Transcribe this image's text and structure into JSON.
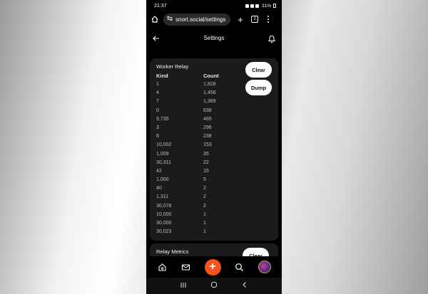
{
  "status_bar": {
    "time": "21:37",
    "battery": "31%"
  },
  "browser": {
    "url": "snort.social/settings",
    "tab_count": "2"
  },
  "header": {
    "title": "Settings"
  },
  "worker_relay": {
    "title": "Worker Relay",
    "clear_label": "Clear",
    "dump_label": "Dump",
    "columns": {
      "kind": "Kind",
      "count": "Count"
    },
    "rows": [
      {
        "kind": "1",
        "count": "1,828"
      },
      {
        "kind": "4",
        "count": "1,456"
      },
      {
        "kind": "7",
        "count": "1,369"
      },
      {
        "kind": "0",
        "count": "638"
      },
      {
        "kind": "9,735",
        "count": "465"
      },
      {
        "kind": "3",
        "count": "296"
      },
      {
        "kind": "6",
        "count": "238"
      },
      {
        "kind": "10,002",
        "count": "153"
      },
      {
        "kind": "1,009",
        "count": "35"
      },
      {
        "kind": "30,311",
        "count": "22"
      },
      {
        "kind": "42",
        "count": "15"
      },
      {
        "kind": "1,000",
        "count": "5"
      },
      {
        "kind": "40",
        "count": "2"
      },
      {
        "kind": "1,311",
        "count": "2"
      },
      {
        "kind": "30,078",
        "count": "2"
      },
      {
        "kind": "10,000",
        "count": "1"
      },
      {
        "kind": "30,000",
        "count": "1"
      },
      {
        "kind": "30,023",
        "count": "1"
      }
    ]
  },
  "relay_metrics": {
    "title": "Relay Metrics",
    "clear_label": "Clear"
  },
  "bottom_nav": {
    "fab_symbol": "+"
  },
  "icons": [
    "home-icon",
    "site-settings-icon",
    "new-tab-icon",
    "menu-icon",
    "back-arrow-icon",
    "bell-icon",
    "mail-icon",
    "search-icon",
    "plus-icon"
  ],
  "colors": {
    "accent": "#f7531e",
    "card": "#1b1b1d",
    "background": "#000000"
  }
}
